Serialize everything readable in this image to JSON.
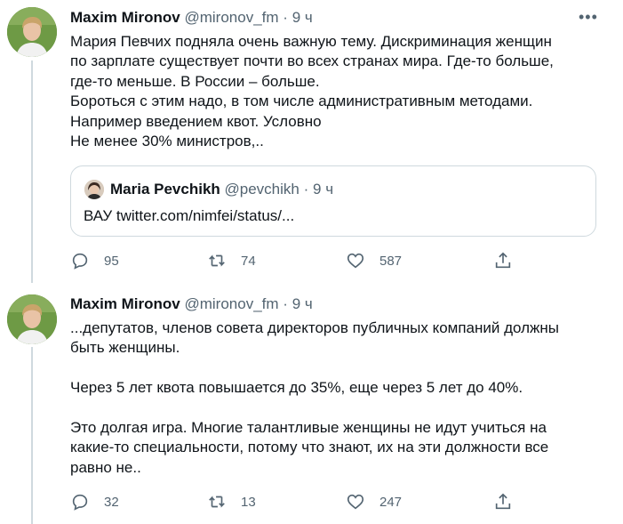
{
  "tweets": [
    {
      "author": {
        "display_name": "Maxim Mironov",
        "handle": "@mironov_fm",
        "separator": "·",
        "time": "9 ч"
      },
      "more_icon": "more-horizontal-icon",
      "text": "Мария Певчих подняла очень важную тему. Дискриминация женщин\nпо зарплате существует почти во всех странах мира. Где-то больше,\nгде-то меньше. В России – больше.\nБороться с этим надо, в том числе административным методами.\nНапример введением квот. Условно\nНе менее 30% министров,..",
      "quote": {
        "author": {
          "display_name": "Maria Pevchikh",
          "handle": "@pevchikh",
          "separator": "·",
          "time": "9 ч"
        },
        "text": "ВАУ twitter.com/nimfei/status/..."
      },
      "actions": {
        "replies": "95",
        "retweets": "74",
        "likes": "587"
      }
    },
    {
      "author": {
        "display_name": "Maxim Mironov",
        "handle": "@mironov_fm",
        "separator": "·",
        "time": "9 ч"
      },
      "text": "...депутатов, членов совета директоров публичных компаний должны\nбыть женщины.\n\nЧерез 5 лет квота повышается до 35%, еще через 5 лет до 40%.\n\nЭто долгая игра. Многие талантливые женщины не идут учиться на\nкакие-то специальности, потому что знают, их на эти должности все\nравно не..",
      "actions": {
        "replies": "32",
        "retweets": "13",
        "likes": "247"
      }
    }
  ],
  "colors": {
    "text_primary": "#0f1419",
    "text_secondary": "#536471",
    "border": "#cfd9de",
    "background": "#ffffff"
  },
  "icons": {
    "reply": "reply-icon",
    "retweet": "retweet-icon",
    "like": "heart-icon",
    "share": "share-icon"
  }
}
